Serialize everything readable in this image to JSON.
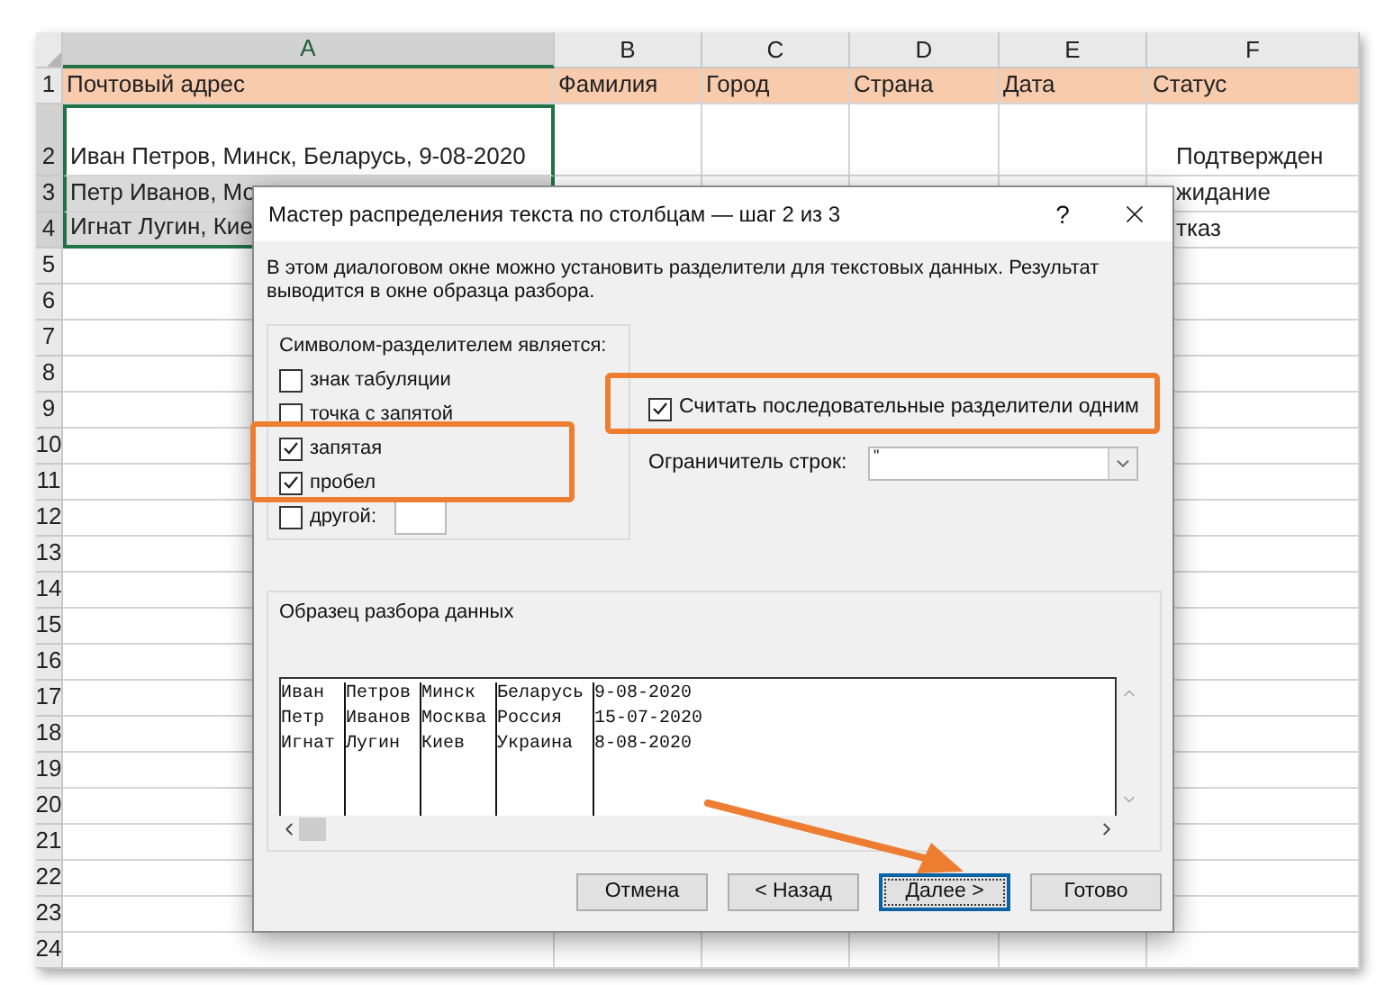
{
  "sheet": {
    "columns": [
      {
        "label": "A",
        "selected": true
      },
      {
        "label": "B",
        "selected": false
      },
      {
        "label": "C",
        "selected": false
      },
      {
        "label": "D",
        "selected": false
      },
      {
        "label": "E",
        "selected": false
      },
      {
        "label": "F",
        "selected": false
      }
    ],
    "rows": [
      {
        "number": "1",
        "kind": "header",
        "selected": false,
        "cells": {
          "A": "Почтовый адрес",
          "B": "Фамилия",
          "C": "Город",
          "D": "Страна",
          "E": "Дата",
          "F": "Статус"
        }
      },
      {
        "number": "2",
        "kind": "tall",
        "selected": true,
        "cells": {
          "A": "Иван Петров, Минск, Беларусь, 9-08-2020",
          "F": "Подтвержден"
        }
      },
      {
        "number": "3",
        "kind": "normal",
        "selected": true,
        "cells": {
          "A": "Петр Иванов, Мо",
          "F": "жидание"
        }
      },
      {
        "number": "4",
        "kind": "normal",
        "selected": true,
        "cells": {
          "A": "Игнат Лугин, Кие",
          "F": "тказ"
        }
      },
      {
        "number": "5",
        "kind": "normal",
        "selected": false
      },
      {
        "number": "6",
        "kind": "normal",
        "selected": false
      },
      {
        "number": "7",
        "kind": "normal",
        "selected": false
      },
      {
        "number": "8",
        "kind": "normal",
        "selected": false
      },
      {
        "number": "9",
        "kind": "normal",
        "selected": false
      },
      {
        "number": "10",
        "kind": "normal",
        "selected": false
      },
      {
        "number": "11",
        "kind": "normal",
        "selected": false
      },
      {
        "number": "12",
        "kind": "normal",
        "selected": false
      },
      {
        "number": "13",
        "kind": "normal",
        "selected": false
      },
      {
        "number": "14",
        "kind": "normal",
        "selected": false
      },
      {
        "number": "15",
        "kind": "normal",
        "selected": false
      },
      {
        "number": "16",
        "kind": "normal",
        "selected": false
      },
      {
        "number": "17",
        "kind": "normal",
        "selected": false
      },
      {
        "number": "18",
        "kind": "normal",
        "selected": false
      },
      {
        "number": "19",
        "kind": "normal",
        "selected": false
      },
      {
        "number": "20",
        "kind": "normal",
        "selected": false
      },
      {
        "number": "21",
        "kind": "normal",
        "selected": false
      },
      {
        "number": "22",
        "kind": "normal",
        "selected": false
      },
      {
        "number": "23",
        "kind": "normal",
        "selected": false
      },
      {
        "number": "24",
        "kind": "normal",
        "selected": false
      }
    ]
  },
  "dialog": {
    "title": "Мастер распределения текста по столбцам — шаг 2 из 3",
    "help": "?",
    "description": "В этом диалоговом окне можно установить разделители для текстовых данных. Результат выводится в окне образца разбора.",
    "delimiters": {
      "title": "Символом-разделителем является:",
      "options": [
        {
          "label": "знак табуляции",
          "checked": false,
          "kind": "plain"
        },
        {
          "label": "точка с запятой",
          "checked": false,
          "kind": "plain"
        },
        {
          "label": "запятая",
          "checked": true,
          "kind": "plain"
        },
        {
          "label": "пробел",
          "checked": true,
          "kind": "plain"
        },
        {
          "label": "другой:",
          "checked": false,
          "kind": "input"
        }
      ]
    },
    "consecutive": {
      "label": "Считать последовательные разделители одним",
      "checked": true
    },
    "qualifier": {
      "label": "Ограничитель строк:",
      "value": "\""
    },
    "preview": {
      "title": "Образец разбора данных",
      "columns": [
        [
          "Иван",
          "Петр",
          "Игнат"
        ],
        [
          "Петров",
          "Иванов",
          "Лугин"
        ],
        [
          "Минск",
          "Москва",
          "Киев"
        ],
        [
          "Беларусь",
          "Россия",
          "Украина"
        ],
        [
          "9-08-2020",
          "15-07-2020",
          "8-08-2020"
        ]
      ]
    },
    "buttons": [
      {
        "label": "Отмена",
        "selected": false
      },
      {
        "label": "< Назад",
        "selected": false
      },
      {
        "label": "Далее >",
        "selected": true
      },
      {
        "label": "Готово",
        "selected": false
      }
    ]
  }
}
